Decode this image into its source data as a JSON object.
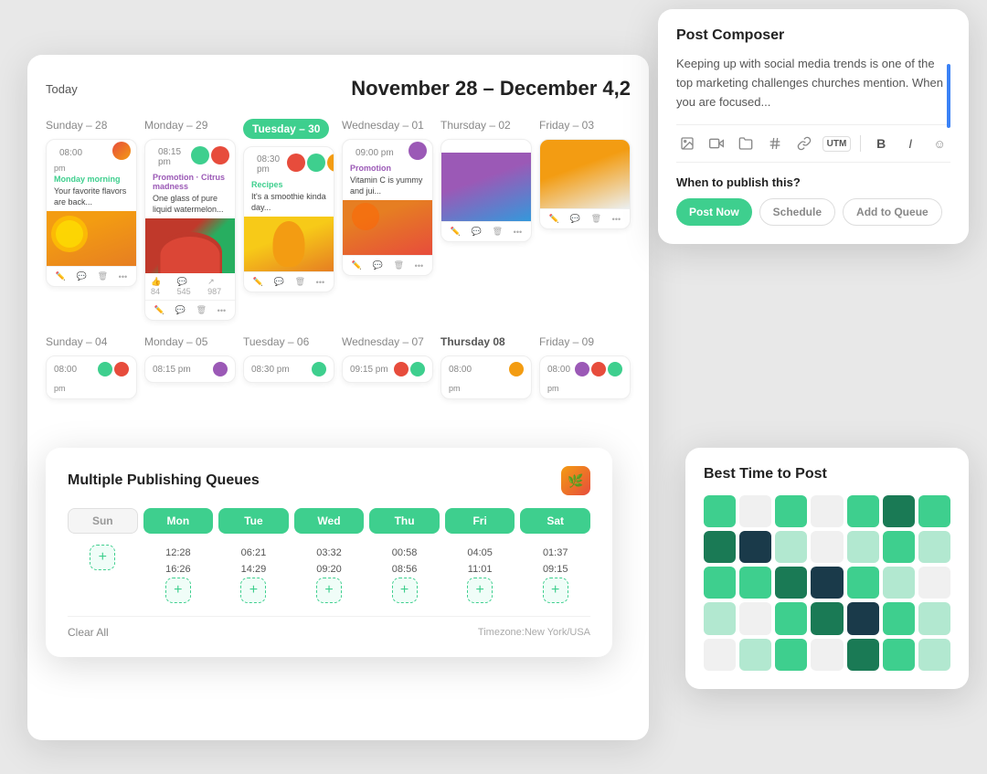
{
  "calendar": {
    "today_label": "Today",
    "date_range": "November 28 – December 4,2",
    "week1": {
      "days": [
        {
          "label": "Sunday – 28",
          "active": false
        },
        {
          "label": "Monday – 29",
          "active": false
        },
        {
          "label": "Tuesday – 30",
          "active": true
        },
        {
          "label": "Wednesday – 01",
          "active": false
        },
        {
          "label": "Thursday – 02",
          "active": false
        },
        {
          "label": "Friday – 03",
          "active": false
        }
      ],
      "posts": [
        {
          "time": "08:00",
          "label": "pm",
          "tag": "Monday morning",
          "text": "Your favorite flavors are back...",
          "img": "orange"
        },
        {
          "time": "08:15 pm",
          "tag": "Promotion · Citrus madness",
          "text": "One glass of pure liquid watermelon...",
          "img": "watermelon",
          "stats": {
            "likes": 84,
            "comments": 545,
            "shares": 987
          }
        },
        {
          "time": "08:30 pm",
          "tag": "Recipes",
          "text": "It's a smoothie kinda day...",
          "img": "mango"
        },
        {
          "time": "09:00 pm",
          "tag": "Promotion",
          "text": "Vitamin C is yummy and jui...",
          "img": "orange2"
        },
        {
          "time": "",
          "tag": "",
          "text": "",
          "img": "grapes"
        },
        {
          "time": "",
          "tag": "",
          "text": "",
          "img": "peach"
        }
      ]
    },
    "week2": {
      "days": [
        {
          "label": "Sunday – 04"
        },
        {
          "label": "Monday – 05"
        },
        {
          "label": "Tuesday – 06"
        },
        {
          "label": "Wednesday – 07"
        },
        {
          "label": "Thursday – 08"
        },
        {
          "label": "Friday – 09"
        }
      ],
      "posts": [
        {
          "time": "08:00",
          "label": "pm"
        },
        {
          "time": "08:15 pm"
        },
        {
          "time": "08:30 pm"
        },
        {
          "time": "09:15 pm"
        },
        {
          "time": "08:00",
          "label": "pm"
        },
        {
          "time": "08:00",
          "label": "pm"
        }
      ]
    }
  },
  "queues": {
    "title": "Multiple Publishing Queues",
    "days": [
      {
        "label": "Sun",
        "active": false
      },
      {
        "label": "Mon",
        "active": true
      },
      {
        "label": "Tue",
        "active": true
      },
      {
        "label": "Wed",
        "active": true
      },
      {
        "label": "Thu",
        "active": true
      },
      {
        "label": "Fri",
        "active": true
      },
      {
        "label": "Sat",
        "active": true
      }
    ],
    "times": [
      {
        "day": "Sun",
        "slots": [],
        "has_add": true
      },
      {
        "day": "Mon",
        "slots": [
          "12:28",
          "16:26"
        ],
        "has_add": true
      },
      {
        "day": "Tue",
        "slots": [
          "06:21",
          "14:29"
        ],
        "has_add": true
      },
      {
        "day": "Wed",
        "slots": [
          "03:32",
          "09:20"
        ],
        "has_add": true
      },
      {
        "day": "Thu",
        "slots": [
          "00:58",
          "08:56"
        ],
        "has_add": true
      },
      {
        "day": "Fri",
        "slots": [
          "04:05",
          "11:01"
        ],
        "has_add": true
      },
      {
        "day": "Sat",
        "slots": [
          "01:37",
          "09:15"
        ],
        "has_add": true
      }
    ],
    "clear_all": "Clear All",
    "timezone": "Timezone:New York/USA"
  },
  "composer": {
    "title": "Post Composer",
    "text": "Keeping up with social media trends is one of the top marketing challenges churches mention. When you are focused...",
    "toolbar_icons": [
      "image-icon",
      "video-icon",
      "folder-icon",
      "hash-icon",
      "link-icon"
    ],
    "utm_label": "UTM",
    "bold_label": "B",
    "italic_label": "I",
    "emoji_label": "☺",
    "when_publish_label": "When to publish this?",
    "publish_options": [
      {
        "label": "Post Now",
        "active": true
      },
      {
        "label": "Schedule",
        "active": false
      },
      {
        "label": "Add to Queue",
        "active": false
      }
    ]
  },
  "best_time": {
    "title": "Best Time to Post",
    "heatmap": [
      [
        "medium",
        "empty",
        "medium",
        "empty",
        "medium",
        "dark",
        "medium"
      ],
      [
        "dark",
        "darker",
        "light",
        "empty",
        "light",
        "medium",
        "light"
      ],
      [
        "medium",
        "medium",
        "dark",
        "darker",
        "medium",
        "light",
        "empty"
      ],
      [
        "light",
        "empty",
        "medium",
        "dark",
        "darker",
        "medium",
        "light"
      ],
      [
        "empty",
        "light",
        "medium",
        "empty",
        "dark",
        "medium",
        "light"
      ]
    ]
  },
  "colors": {
    "green": "#3ecf8e",
    "dark_navy": "#1a3a4a",
    "blue": "#3b82f6"
  }
}
